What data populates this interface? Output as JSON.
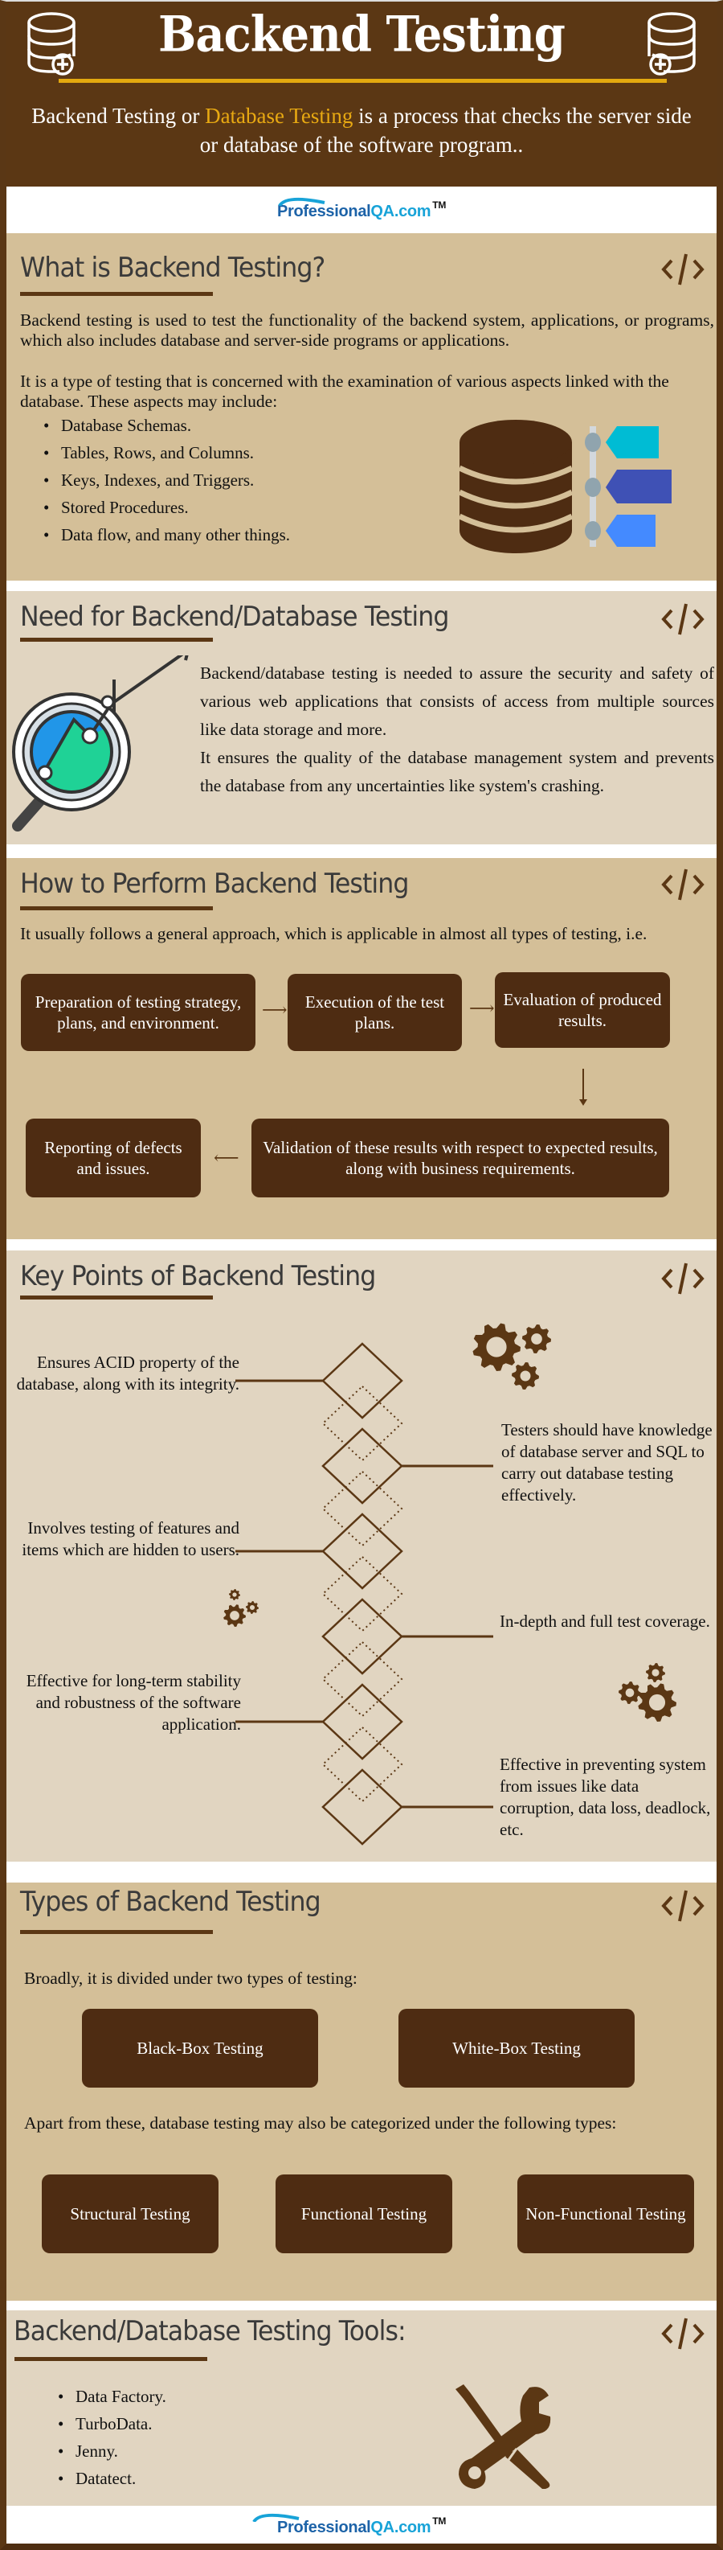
{
  "header": {
    "title": "Backend Testing",
    "subtitle_part1": "Backend Testing or ",
    "subtitle_highlight": "Database Testing",
    "subtitle_part2": " is a process that checks the server side or database of the software program..",
    "highlight_color": "#e8a912",
    "icons": [
      "database-add-icon",
      "database-add-icon"
    ]
  },
  "logo": {
    "part1": "Professional",
    "part2": "QA",
    "part3": ".com",
    "tm": "TM"
  },
  "sections": {
    "what": {
      "title": "What is Backend Testing?",
      "paragraph1": "Backend testing is used to test the functionality of the backend system, applications, or programs, which also includes database and server-side programs or applications.",
      "paragraph2": "It is a type of testing that is concerned with the examination of various aspects linked with the database. These aspects may include:",
      "bullets": [
        "Database Schemas.",
        "Tables, Rows, and Columns.",
        "Keys, Indexes, and Triggers.",
        "Stored Procedures.",
        "Data flow, and many other things."
      ],
      "illustration": "database-tags-icon",
      "tag_colors": [
        "#00bcd4",
        "#3f51b5",
        "#448aff"
      ]
    },
    "need": {
      "title": "Need for Backend/Database Testing",
      "paragraph1": "Backend/database testing is needed to assure the security and safety of various web applications that consists of access from multiple sources like data storage and more.",
      "paragraph2": "It ensures the quality of the database management system and prevents the database from any uncertainties like system's crashing.",
      "illustration": "magnifier-chart-icon"
    },
    "how": {
      "title": "How to Perform Backend Testing",
      "intro": "It usually follows a general approach, which is applicable in almost all types of testing, i.e.",
      "steps": [
        "Preparation of testing strategy, plans, and environment.",
        "Execution of the test plans.",
        "Evaluation of produced results.",
        "Validation of these results with respect to expected results, along with business requirements.",
        "Reporting of defects and issues."
      ]
    },
    "key_points": {
      "title": "Key Points of Backend Testing",
      "points": [
        "Ensures ACID property of the database, along with its integrity.",
        "Testers should have knowledge of database server and SQL to carry out database testing effectively.",
        "Involves testing of features and items which are hidden to users.",
        "In-depth and full test coverage.",
        "Effective for long-term stability and robustness of the software application.",
        "Effective in preventing system from issues like data corruption, data loss, deadlock, etc."
      ]
    },
    "types": {
      "title": "Types of Backend Testing",
      "intro": "Broadly, it is divided under two types of testing:",
      "primary": [
        "Black-Box Testing",
        "White-Box Testing"
      ],
      "intro2": "Apart from these, database testing may also be categorized under the following types:",
      "secondary": [
        "Structural Testing",
        "Functional Testing",
        "Non-Functional Testing"
      ]
    },
    "tools": {
      "title": "Backend/Database Testing Tools:",
      "items": [
        "Data Factory.",
        "TurboData.",
        "Jenny.",
        "Datatect."
      ],
      "illustration": "tools-icon"
    }
  },
  "colors": {
    "brown": "#5b3714",
    "box_brown": "#4e2c12",
    "tan": "#d4bf98",
    "beige": "#e1d5c1",
    "gold": "#e3a90f"
  }
}
